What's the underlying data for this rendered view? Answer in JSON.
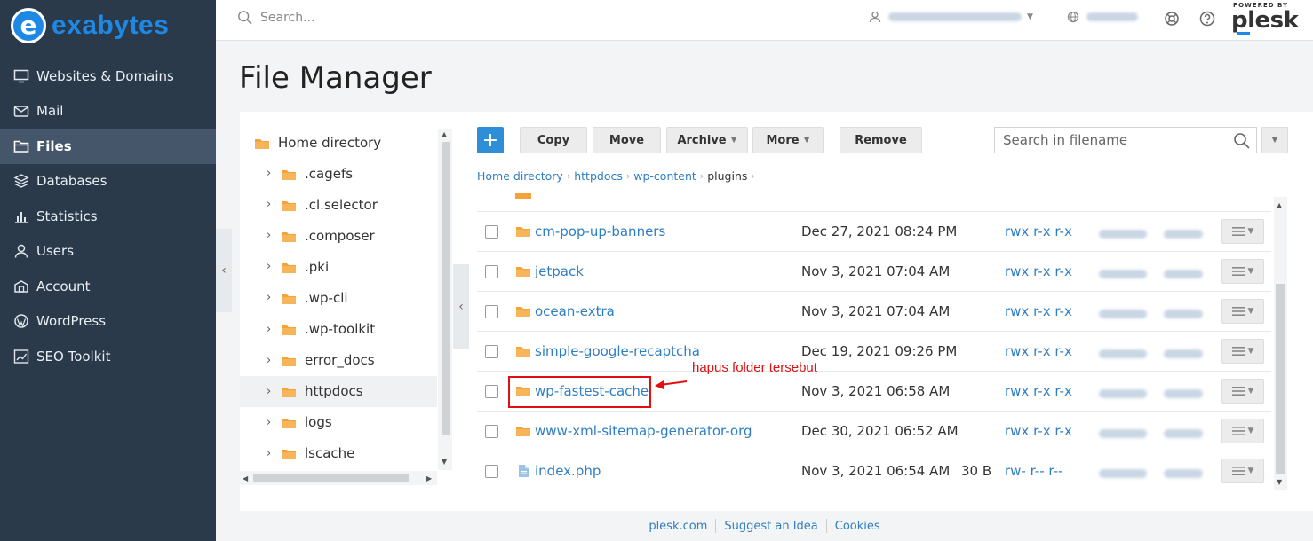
{
  "brand": {
    "logo_letter": "e",
    "name": "exabytes"
  },
  "sidebar": {
    "items": [
      {
        "label": "Websites & Domains",
        "icon": "monitor-icon"
      },
      {
        "label": "Mail",
        "icon": "mail-icon"
      },
      {
        "label": "Files",
        "icon": "folder-icon",
        "active": true
      },
      {
        "label": "Databases",
        "icon": "database-icon"
      },
      {
        "label": "Statistics",
        "icon": "bar-chart-icon"
      },
      {
        "label": "Users",
        "icon": "user-icon"
      },
      {
        "label": "Account",
        "icon": "account-icon"
      },
      {
        "label": "WordPress",
        "icon": "wordpress-icon"
      },
      {
        "label": "SEO Toolkit",
        "icon": "seo-icon"
      }
    ]
  },
  "topbar": {
    "search_placeholder": "Search...",
    "powered_by": "POWERED BY",
    "plesk": "plesk"
  },
  "page": {
    "title": "File Manager"
  },
  "tree": {
    "root": "Home directory",
    "items": [
      {
        "label": ".cagefs"
      },
      {
        "label": ".cl.selector"
      },
      {
        "label": ".composer"
      },
      {
        "label": ".pki"
      },
      {
        "label": ".wp-cli"
      },
      {
        "label": ".wp-toolkit"
      },
      {
        "label": "error_docs"
      },
      {
        "label": "httpdocs",
        "selected": true
      },
      {
        "label": "logs"
      },
      {
        "label": "lscache"
      }
    ]
  },
  "toolbar": {
    "add_label": "+",
    "copy": "Copy",
    "move": "Move",
    "archive": "Archive",
    "more": "More",
    "remove": "Remove",
    "search_placeholder": "Search in filename"
  },
  "breadcrumb": [
    "Home directory",
    "httpdocs",
    "wp-content",
    "plugins"
  ],
  "files": [
    {
      "name": "cm-pop-up-banners",
      "type": "folder",
      "date": "Dec 27, 2021 08:24 PM",
      "size": "",
      "perm": "rwx r-x r-x"
    },
    {
      "name": "jetpack",
      "type": "folder",
      "date": "Nov 3, 2021 07:04 AM",
      "size": "",
      "perm": "rwx r-x r-x"
    },
    {
      "name": "ocean-extra",
      "type": "folder",
      "date": "Nov 3, 2021 07:04 AM",
      "size": "",
      "perm": "rwx r-x r-x"
    },
    {
      "name": "simple-google-recaptcha",
      "type": "folder",
      "date": "Dec 19, 2021 09:26 PM",
      "size": "",
      "perm": "rwx r-x r-x"
    },
    {
      "name": "wp-fastest-cache",
      "type": "folder",
      "date": "Nov 3, 2021 06:58 AM",
      "size": "",
      "perm": "rwx r-x r-x"
    },
    {
      "name": "www-xml-sitemap-generator-org",
      "type": "folder",
      "date": "Dec 30, 2021 06:52 AM",
      "size": "",
      "perm": "rwx r-x r-x"
    },
    {
      "name": "index.php",
      "type": "file",
      "date": "Nov 3, 2021 06:54 AM",
      "size": "30 B",
      "perm": "rw- r-- r--"
    }
  ],
  "annotation": {
    "text": "hapus folder tersebut"
  },
  "footer": {
    "links": [
      "plesk.com",
      "Suggest an Idea",
      "Cookies"
    ]
  },
  "colors": {
    "sidebar_bg": "#2b3a4a",
    "accent": "#2e8fd6",
    "link": "#2e7ec4",
    "annotation": "#e01010",
    "folder": "#f5a23a"
  }
}
